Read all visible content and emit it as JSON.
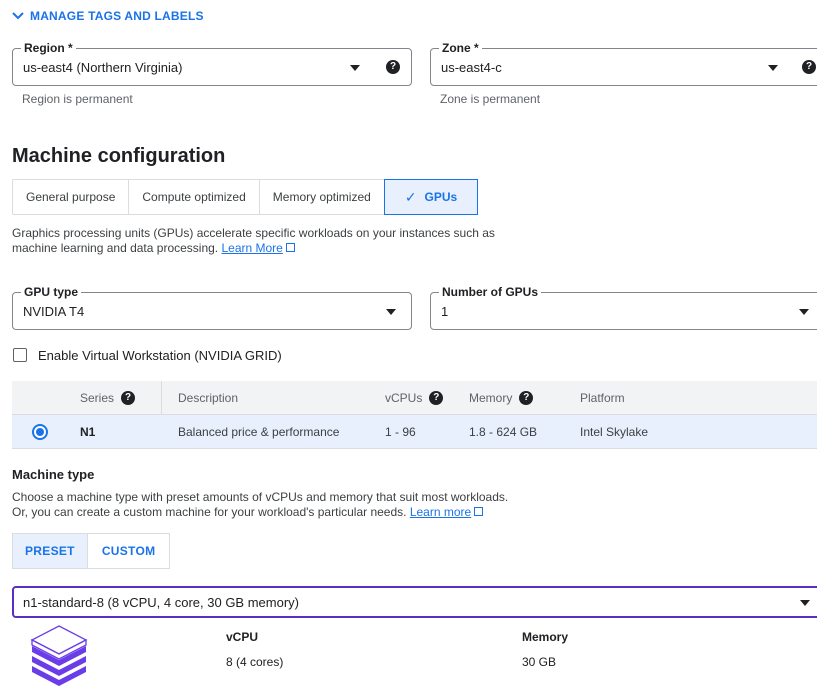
{
  "manage_tags": {
    "label": "MANAGE TAGS AND LABELS"
  },
  "region": {
    "label": "Region *",
    "value": "us-east4 (Northern Virginia)",
    "hint": "Region is permanent"
  },
  "zone": {
    "label": "Zone *",
    "value": "us-east4-c",
    "hint": "Zone is permanent"
  },
  "machine_config": {
    "title": "Machine configuration",
    "tabs": [
      {
        "label": "General purpose"
      },
      {
        "label": "Compute optimized"
      },
      {
        "label": "Memory optimized"
      },
      {
        "label": "GPUs",
        "selected": true
      }
    ],
    "description_line1": "Graphics processing units (GPUs) accelerate specific workloads on your instances such as",
    "description_line2": "machine learning and data processing.",
    "learn_more": "Learn More"
  },
  "gpu_type": {
    "label": "GPU type",
    "value": "NVIDIA T4"
  },
  "gpu_count": {
    "label": "Number of GPUs",
    "value": "1"
  },
  "virtual_workstation": {
    "label": "Enable Virtual Workstation (NVIDIA GRID)",
    "checked": false
  },
  "series_table": {
    "headers": {
      "series": "Series",
      "description": "Description",
      "vcpus": "vCPUs",
      "memory": "Memory",
      "platform": "Platform"
    },
    "rows": [
      {
        "series": "N1",
        "description": "Balanced price & performance",
        "vcpus": "1 - 96",
        "memory": "1.8 - 624 GB",
        "platform": "Intel Skylake",
        "selected": true
      }
    ]
  },
  "machine_type": {
    "title": "Machine type",
    "description_line1": "Choose a machine type with preset amounts of vCPUs and memory that suit most workloads.",
    "description_line2": "Or, you can create a custom machine for your workload's particular needs.",
    "learn_more": "Learn more",
    "preset_label": "PRESET",
    "custom_label": "CUSTOM",
    "selected_value": "n1-standard-8 (8 vCPU, 4 core, 30 GB memory)",
    "vcpu_label": "vCPU",
    "vcpu_value": "8 (4 cores)",
    "memory_label": "Memory",
    "memory_value": "30 GB"
  },
  "colors": {
    "accent": "#1a73e8",
    "selected_bg": "#e8f0fe",
    "focus_border": "#5b2ec2",
    "stack_icon": "#6a3de8"
  }
}
